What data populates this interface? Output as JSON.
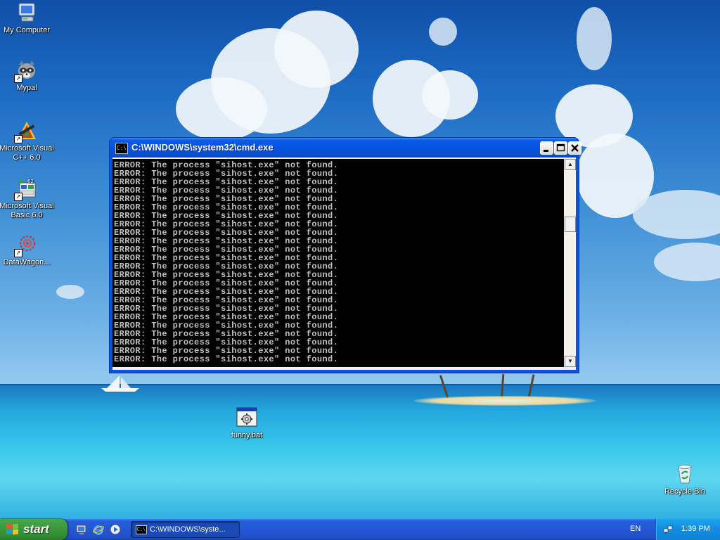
{
  "desktop": {
    "icons": [
      {
        "label": "My Computer",
        "icon": "my-computer-icon"
      },
      {
        "label": "Mypal",
        "icon": "mypal-raccoon-icon"
      },
      {
        "label": "Microsoft Visual C++ 6.0",
        "icon": "visual-cpp-icon"
      },
      {
        "label": "Microsoft Visual Basic 6.0",
        "icon": "visual-basic-icon"
      },
      {
        "label": "DataWagon...",
        "icon": "datawagon-icon"
      },
      {
        "label": "funny.bat",
        "icon": "batch-file-icon"
      },
      {
        "label": "Recycle Bin",
        "icon": "recycle-bin-icon"
      }
    ]
  },
  "window": {
    "title": "C:\\WINDOWS\\system32\\cmd.exe",
    "icon_text": "C:\\",
    "console_lines": [
      "ERROR: The process \"sihost.exe\" not found.",
      "ERROR: The process \"sihost.exe\" not found.",
      "ERROR: The process \"sihost.exe\" not found.",
      "ERROR: The process \"sihost.exe\" not found.",
      "ERROR: The process \"sihost.exe\" not found.",
      "ERROR: The process \"sihost.exe\" not found.",
      "ERROR: The process \"sihost.exe\" not found.",
      "ERROR: The process \"sihost.exe\" not found.",
      "ERROR: The process \"sihost.exe\" not found.",
      "ERROR: The process \"sihost.exe\" not found.",
      "ERROR: The process \"sihost.exe\" not found.",
      "ERROR: The process \"sihost.exe\" not found.",
      "ERROR: The process \"sihost.exe\" not found.",
      "ERROR: The process \"sihost.exe\" not found.",
      "ERROR: The process \"sihost.exe\" not found.",
      "ERROR: The process \"sihost.exe\" not found.",
      "ERROR: The process \"sihost.exe\" not found.",
      "ERROR: The process \"sihost.exe\" not found.",
      "ERROR: The process \"sihost.exe\" not found.",
      "ERROR: The process \"sihost.exe\" not found.",
      "ERROR: The process \"sihost.exe\" not found.",
      "ERROR: The process \"sihost.exe\" not found.",
      "ERROR: The process \"sihost.exe\" not found.",
      "ERROR: The process \"sihost.exe\" not found."
    ],
    "colors": {
      "console_bg": "#000000",
      "console_fg": "#c0c0c0",
      "titlebar": "#0653df"
    }
  },
  "taskbar": {
    "start_label": "start",
    "task_button_label": "C:\\WINDOWS\\syste...",
    "language": "EN",
    "clock": "1:39 PM",
    "colors": {
      "bar": "#245edb",
      "start": "#3c9a3c",
      "tray": "#1290e3"
    }
  }
}
